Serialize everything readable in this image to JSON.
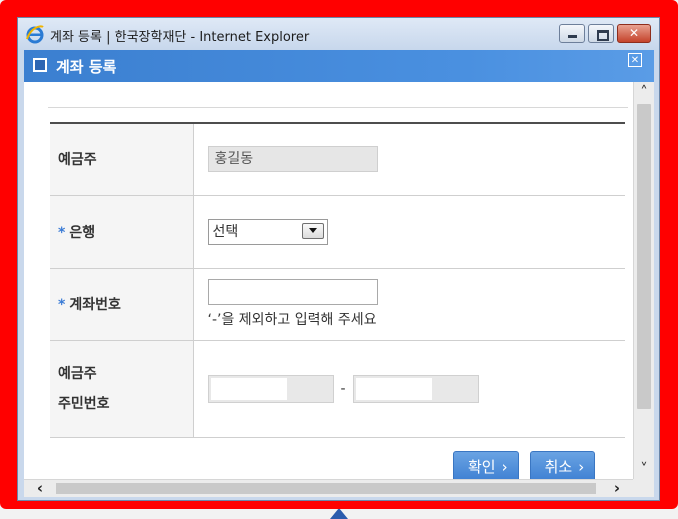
{
  "window": {
    "title": "계좌 등록 | 한국장학재단 - Internet Explorer",
    "minimize_label": "",
    "maximize_label": "",
    "close_label": "✕"
  },
  "popup": {
    "title": "계좌 등록",
    "close_glyph": "✕"
  },
  "form": {
    "required_mark": "*",
    "account_holder": {
      "label": "예금주",
      "value": "홍길동"
    },
    "bank": {
      "label": "은행",
      "selected": "선택"
    },
    "account_number": {
      "label": "계좌번호",
      "value": "",
      "hint": "‘-’을 제외하고 입력해 주세요"
    },
    "resident_number": {
      "label_line1": "예금주",
      "label_line2": "주민번호",
      "separator": "-"
    }
  },
  "buttons": {
    "confirm": "확인",
    "cancel": "취소",
    "chevron": "›"
  },
  "scrollbars": {
    "up": "˄",
    "down": "˅",
    "left": "‹",
    "right": "›"
  },
  "colors": {
    "highlight_border": "#ff0000",
    "popup_header": "#3b7fd0",
    "button": "#4a8ad8"
  },
  "icons": {
    "browser": "internet-explorer-icon",
    "popup_header": "window-square-icon"
  }
}
